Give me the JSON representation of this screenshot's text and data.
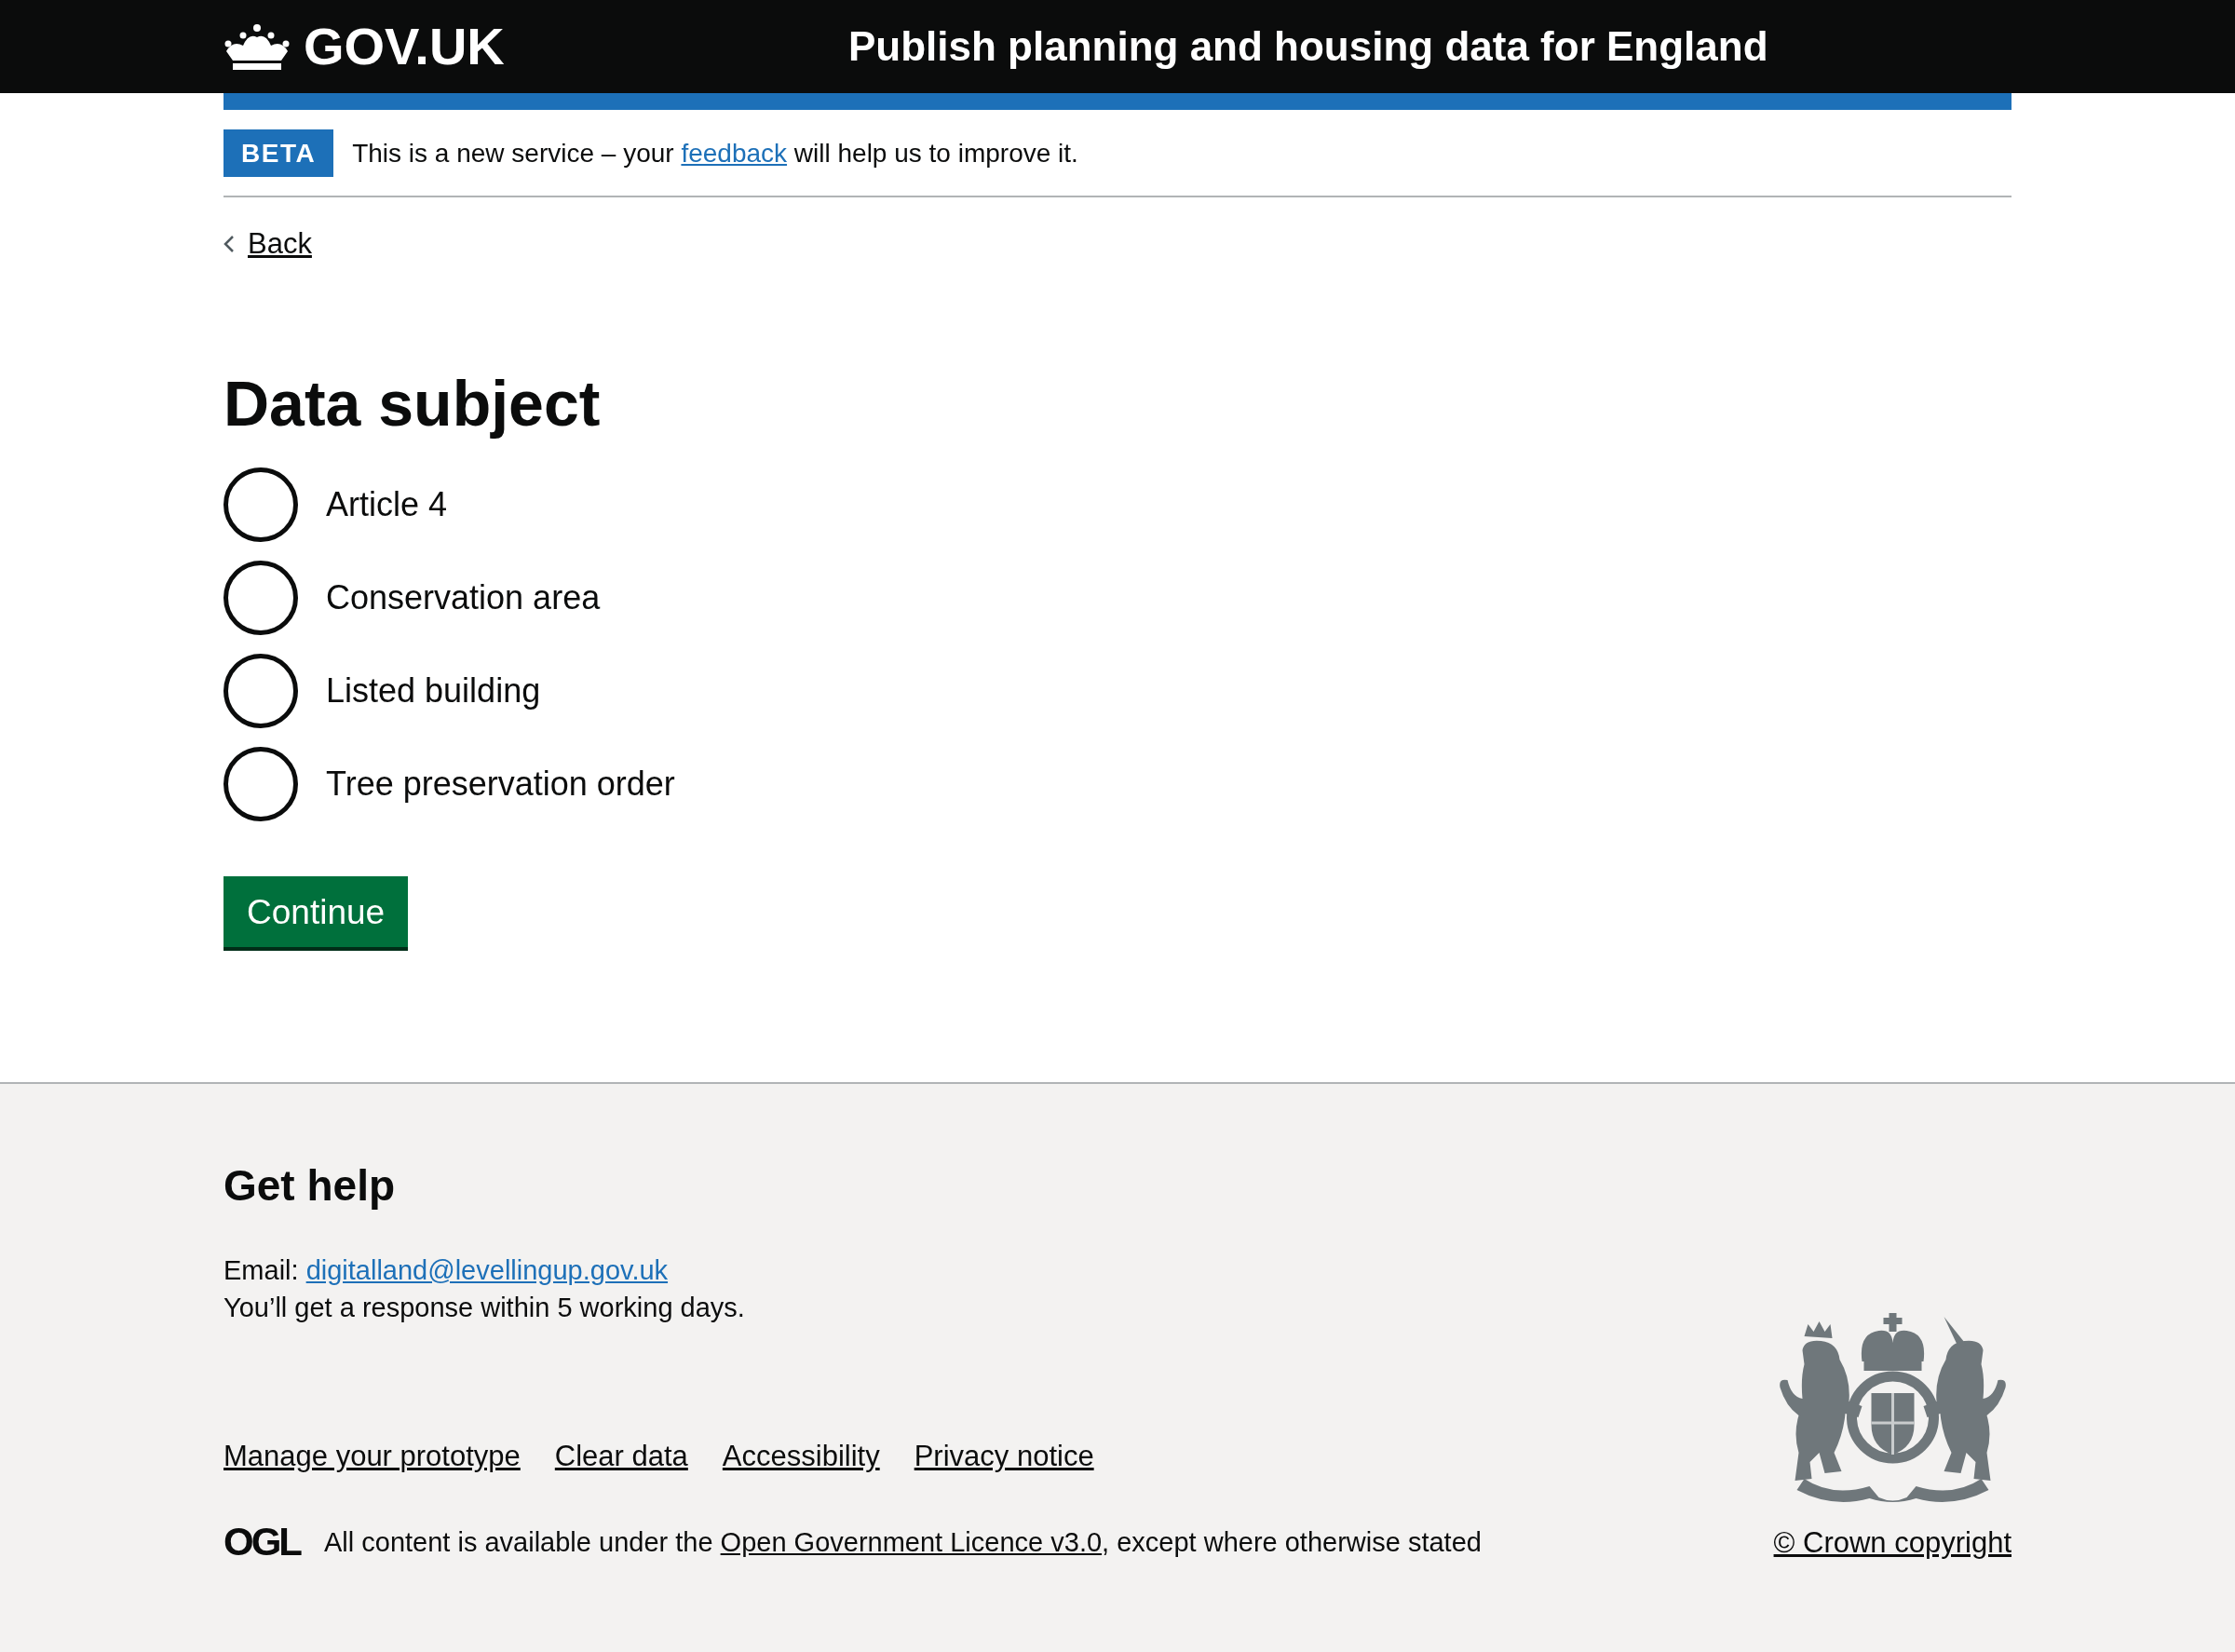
{
  "header": {
    "logo_text": "GOV.UK",
    "service_name": "Publish planning and housing data for England"
  },
  "phase_banner": {
    "tag": "BETA",
    "text_before": "This is a new service – your",
    "link": "feedback",
    "text_after": "will help us to improve it."
  },
  "back_link": "Back",
  "form": {
    "heading": "Data subject",
    "options": [
      {
        "label": "Article 4",
        "selected": false
      },
      {
        "label": "Conservation area",
        "selected": false
      },
      {
        "label": "Listed building",
        "selected": false
      },
      {
        "label": "Tree preservation order",
        "selected": false
      }
    ],
    "button": "Continue"
  },
  "footer": {
    "help_heading": "Get help",
    "email_label": "Email:",
    "email": "digitalland@levellingup.gov.uk",
    "response_note": "You’ll get a response within 5 working days.",
    "links": [
      "Manage your prototype",
      "Clear data",
      "Accessibility",
      "Privacy notice"
    ],
    "licence_logo": "OGL",
    "licence_before": "All content is available under the",
    "licence_link": "Open Government Licence v3.0",
    "licence_after": ", except where otherwise stated",
    "copyright": "© Crown copyright"
  }
}
